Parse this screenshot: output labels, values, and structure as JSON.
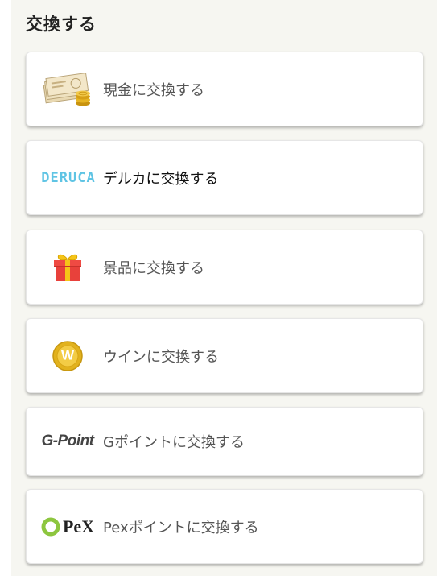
{
  "section": {
    "title": "交換する"
  },
  "options": [
    {
      "id": "cash",
      "label": "現金に交換する",
      "icon": "cash-banknotes-coins-icon"
    },
    {
      "id": "deruca",
      "label": "デルカに交換する",
      "icon": "deruca-logo",
      "logo_text": "DERUCA"
    },
    {
      "id": "prize",
      "label": "景品に交換する",
      "icon": "gift-box-icon"
    },
    {
      "id": "win",
      "label": "ウインに交換する",
      "icon": "win-coin-icon",
      "logo_text": "W"
    },
    {
      "id": "gpoint",
      "label": "Gポイントに交換する",
      "icon": "gpoint-logo",
      "logo_text": "G-Point"
    },
    {
      "id": "pex",
      "label": "Pexポイントに交換する",
      "icon": "pex-logo",
      "logo_text": "PeX"
    }
  ],
  "colors": {
    "panel_background": "#f6f6f1",
    "card_background": "#ffffff",
    "label_text": "#555555",
    "deruca_blue": "#5fc4e4",
    "gift_red": "#e8413b",
    "coin_gold": "#e2b21d",
    "gpoint_orange": "#e9742b",
    "pex_green": "#8dc63f"
  }
}
